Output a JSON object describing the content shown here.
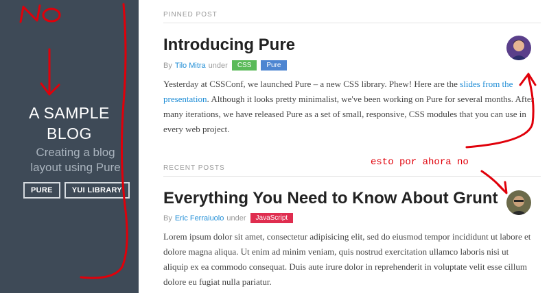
{
  "sidebar": {
    "title_line1": "A SAMPLE",
    "title_line2": "BLOG",
    "tagline": "Creating a blog layout using Pure",
    "nav": [
      {
        "label": "PURE"
      },
      {
        "label": "YUI LIBRARY"
      }
    ]
  },
  "pinned": {
    "heading": "PINNED POST",
    "title": "Introducing Pure",
    "meta_by": "By",
    "author": "Tilo Mitra",
    "meta_under": "under",
    "tags": [
      {
        "label": "CSS",
        "color": "#5aba59"
      },
      {
        "label": "Pure",
        "color": "#4d85d1"
      }
    ],
    "body_before": "Yesterday at CSSConf, we launched Pure – a new CSS library. Phew! Here are the ",
    "body_link": "slides from the presentation",
    "body_after": ". Although it looks pretty minimalist, we've been working on Pure for several months. After many iterations, we have released Pure as a set of small, responsive, CSS modules that you can use in every web project."
  },
  "recent": {
    "heading": "RECENT POSTS",
    "title": "Everything You Need to Know About Grunt",
    "meta_by": "By",
    "author": "Eric Ferraiuolo",
    "meta_under": "under",
    "tags": [
      {
        "label": "JavaScript",
        "color": "#df2d4f"
      }
    ],
    "body": "Lorem ipsum dolor sit amet, consectetur adipisicing elit, sed do eiusmod tempor incididunt ut labore et dolore magna aliqua. Ut enim ad minim veniam, quis nostrud exercitation ullamco laboris nisi ut aliquip ex ea commodo consequat. Duis aute irure dolor in reprehenderit in voluptate velit esse cillum dolore eu fugiat nulla pariatur."
  },
  "annotations": {
    "no_text": "NO",
    "note_text": "esto por ahora no",
    "color": "#e0000a"
  }
}
